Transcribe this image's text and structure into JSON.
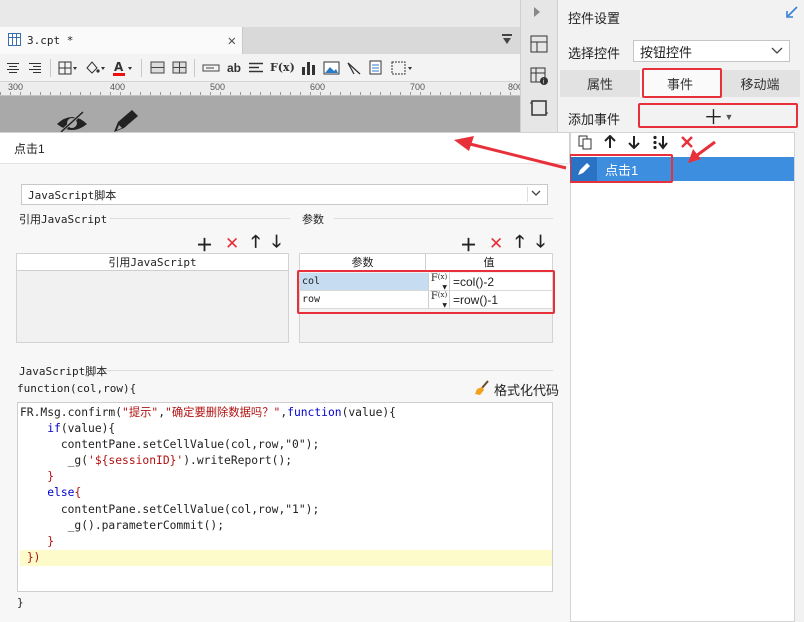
{
  "designer": {
    "tab_label": "3.cpt *",
    "ruler_ticks": [
      "300",
      "400",
      "500",
      "600",
      "700",
      "800"
    ]
  },
  "toolbar": {
    "font_format_label": "F(x)",
    "text_label": "ab"
  },
  "right_panel": {
    "title": "控件设置",
    "select_label": "选择控件",
    "select_value": "按钮控件",
    "tabs": [
      "属性",
      "事件",
      "移动端"
    ],
    "add_event_label": "添加事件",
    "event_item": "点击1"
  },
  "dialog": {
    "title": "点击1",
    "type_select": "JavaScript脚本",
    "ref_js_label": "引用JavaScript",
    "ref_js_header": "引用JavaScript",
    "params_label": "参数",
    "params_headers": [
      "参数",
      "值"
    ],
    "params": [
      {
        "name": "col",
        "value": "=col()-2"
      },
      {
        "name": "row",
        "value": "=row()-1"
      }
    ],
    "script_label": "JavaScript脚本",
    "signature": "function(col,row){",
    "format_button": "格式化代码",
    "closing": "}"
  },
  "code": {
    "l1_obj": "FR.Msg.confirm(",
    "l1_s1": "\"提示\"",
    "l1_comma": ",",
    "l1_s2": "\"确定要删除数据吗？\"",
    "l1_kw": "function",
    "l1_tail": "(value){",
    "l2_kw": "if",
    "l2_tail": "(value){",
    "l3": "contentPane.setCellValue(col,row,\"0\");",
    "l4_a": "_g(",
    "l4_s": "'${sessionID}'",
    "l4_b": ").writeReport();",
    "l5": "}",
    "l6_kw": "else",
    "l6_tail": "{",
    "l7": "contentPane.setCellValue(col,row,\"1\");",
    "l8": "_g().parameterCommit();",
    "l9": "}",
    "l10": "})"
  },
  "colors": {
    "accent": "#3e8ee0",
    "highlight": "#e8303a",
    "selection": "#c6dcf0"
  }
}
